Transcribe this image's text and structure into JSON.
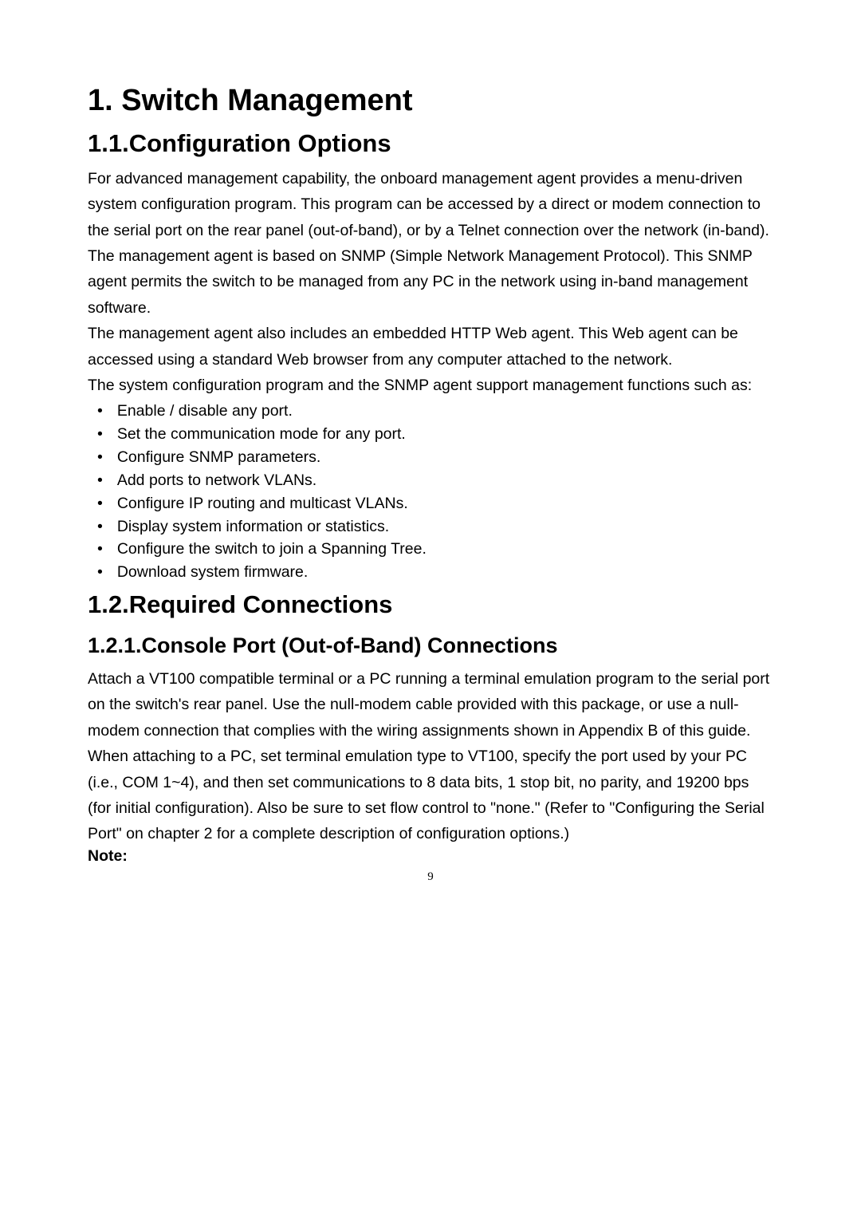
{
  "headings": {
    "h1": "1. Switch Management",
    "h2_1": "1.1.Configuration Options",
    "h2_2": "1.2.Required Connections",
    "h3_1": "1.2.1.Console Port (Out-of-Band) Connections"
  },
  "paragraphs": {
    "p1": "For advanced management capability, the onboard management agent provides a menu-driven system configuration program. This program can be accessed by a direct or modem connection to the serial port on the rear panel (out-of-band), or by a Telnet connection over the network (in-band).",
    "p2": "The management agent is based on SNMP (Simple Network Management Protocol). This SNMP agent permits the switch to be managed from any PC in the network using in-band management software.",
    "p3": "The management agent also includes an embedded HTTP Web agent. This Web agent can be accessed using a standard Web browser from any computer attached to the network.",
    "p4": "The system configuration program and the SNMP agent support management functions such as:",
    "p5": "Attach a VT100 compatible terminal or a PC running a terminal emulation program to the serial port on the switch's rear panel. Use the null-modem cable provided with this package, or use a null-modem connection that complies with the wiring assignments shown in Appendix B of this guide.",
    "p6": "When attaching to a PC, set terminal emulation type to VT100, specify the port used by your PC (i.e., COM 1~4), and then set communications to 8 data bits, 1 stop bit, no parity, and 19200 bps (for initial configuration). Also be sure to set flow control to \"none.\" (Refer to \"Configuring the Serial Port\" on chapter 2 for a complete description of configuration options.)"
  },
  "list_items": [
    "Enable / disable any port.",
    "Set the communication mode for any port.",
    "Configure SNMP parameters.",
    "Add ports to network VLANs.",
    "Configure IP routing and multicast VLANs.",
    "Display system information or statistics.",
    "Configure the switch to join a Spanning Tree.",
    "Download system firmware."
  ],
  "note_label": "Note:",
  "page_number": "9",
  "bullet": "•"
}
